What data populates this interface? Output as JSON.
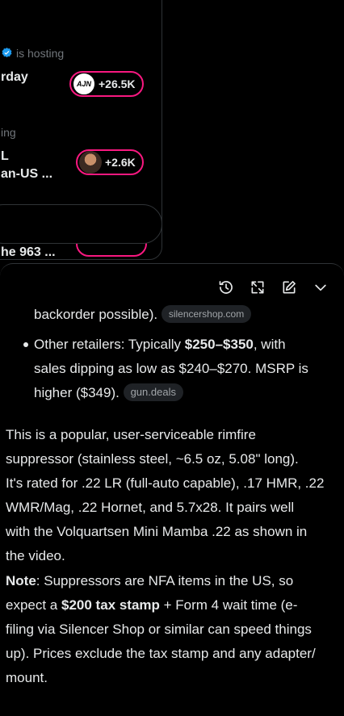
{
  "spaces": [
    {
      "host_text": "is hosting",
      "title_lines": [
        "rday"
      ],
      "listeners": "+26.5K",
      "avatar_text": "AJN"
    },
    {
      "host_text": "ing",
      "title_lines": [
        "L",
        "an-US ..."
      ],
      "listeners": "+2.6K"
    },
    {
      "title_lines": [
        "he 963 ..."
      ]
    }
  ],
  "toolbar": {
    "history_icon": "history-icon",
    "expand_icon": "expand-icon",
    "compose_icon": "compose-icon",
    "collapse_icon": "chevron-down-icon"
  },
  "answer": {
    "bullet1_tail": "backorder possible).",
    "bullet1_source": "silencershop.com",
    "bullet2": {
      "label": "Other retailers: Typically ",
      "bold": "$250–$350",
      "after": ", with",
      "line2": "sales dipping as low as $240–$270. MSRP is",
      "line3": "higher ($349).",
      "source": "gun.deals"
    },
    "para1": [
      "This is a popular, user-serviceable rimfire",
      "suppressor (stainless steel, ~6.5 oz, 5.08\" long).",
      "It's rated for .22 LR (full-auto capable), .17 HMR, .22",
      "WMR/Mag, .22 Hornet, and 5.7x28. It pairs well",
      "with the Volquartsen Mini Mamba .22 as shown in",
      "the video."
    ],
    "note": {
      "label": "Note",
      "line1_rest": ": Suppressors are NFA items in the US, so",
      "line2_pre": "expect a ",
      "line2_bold": "$200 tax stamp",
      "line2_post": " + Form 4 wait time (e-",
      "line3": "filing via Silencer Shop or similar can speed things",
      "line4": "up). Prices exclude the tax stamp and any adapter/",
      "line5": "mount."
    }
  }
}
